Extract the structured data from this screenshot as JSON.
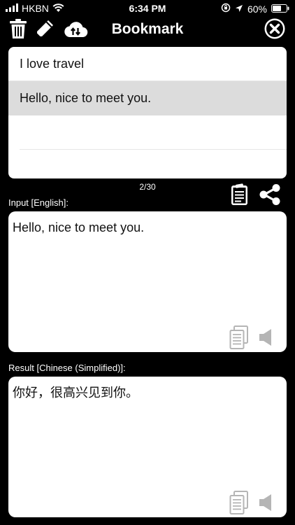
{
  "status_bar": {
    "carrier": "HKBN",
    "time": "6:34 PM",
    "battery": "60%"
  },
  "toolbar": {
    "title": "Bookmark"
  },
  "bookmarks": {
    "items": [
      "I love travel",
      "Hello, nice to meet you."
    ],
    "selected_index": 1,
    "pager": "2/30"
  },
  "input": {
    "label": "Input [English]:",
    "text": "Hello, nice to meet you."
  },
  "result": {
    "label": "Result [Chinese (Simplified)]:",
    "text": "你好，很高兴见到你。"
  },
  "icons": {
    "trash": "trash-icon",
    "edit": "pencil-icon",
    "cloud": "cloud-sync-icon",
    "close": "close-icon",
    "notes": "clipboard-icon",
    "share": "share-icon",
    "copy": "copy-icon",
    "speaker": "speaker-icon"
  },
  "colors": {
    "background": "#000000",
    "panel": "#ffffff",
    "selected_row": "#dcdcdc",
    "icon_gray": "#b5b5b5"
  }
}
